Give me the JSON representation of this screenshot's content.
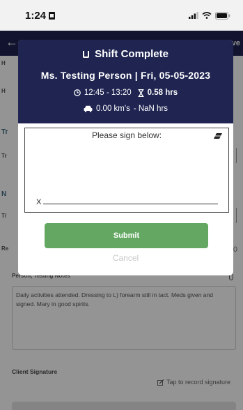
{
  "status_bar": {
    "time": "1:24"
  },
  "header": {
    "back_glyph": "←",
    "save_label": "Save"
  },
  "background_form": {
    "row_stubs": [
      "H",
      "H",
      "Tr",
      "T/",
      "Re"
    ],
    "section_stubs": [
      "Tr",
      "N"
    ],
    "right_value": "0",
    "notes_label": "Person, Testing Notes *",
    "notes_text": "Daily activities attended. Dressing to L) forearm still in tact. Meds given and signed. Mary in good spirits.",
    "client_signature_label": "Client Signature",
    "tap_to_record": "Tap to record signature"
  },
  "modal": {
    "title": "Shift Complete",
    "subtitle": "Ms. Testing Person | Fri, 05-05-2023",
    "time_range": "12:45 - 13:20",
    "hours": "0.58 hrs",
    "km": "0.00 km's",
    "km_hours": "- NaN hrs",
    "sign_prompt": "Please sign below:",
    "sign_x": "X",
    "submit_label": "Submit",
    "cancel_label": "Cancel"
  },
  "colors": {
    "header_navy": "#1f2451",
    "submit_green": "#63a762",
    "section_blue": "#3d6b86"
  },
  "icons": [
    "sim-icon",
    "signal-icon",
    "wifi-icon",
    "battery-icon",
    "back-arrow-icon",
    "clipboard-icon",
    "clock-icon",
    "hourglass-icon",
    "car-icon",
    "eraser-icon",
    "mic-icon",
    "pen-icon"
  ]
}
